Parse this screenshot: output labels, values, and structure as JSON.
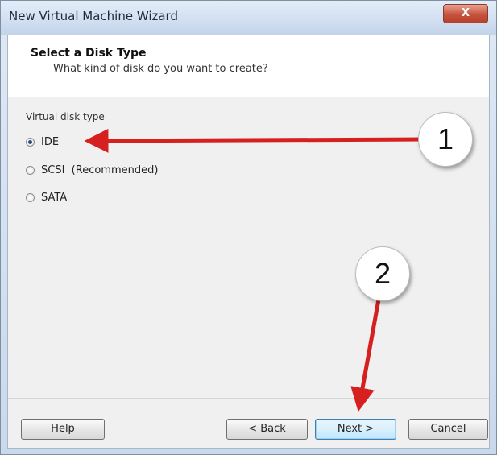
{
  "window": {
    "title": "New Virtual Machine Wizard",
    "close_label": "X"
  },
  "header": {
    "title": "Select a Disk Type",
    "subtitle": "What kind of disk do you want to create?"
  },
  "disk_type": {
    "group_label": "Virtual disk type",
    "options": [
      {
        "label": "IDE",
        "checked": true
      },
      {
        "label": "SCSI  (Recommended)",
        "checked": false
      },
      {
        "label": "SATA",
        "checked": false
      }
    ]
  },
  "buttons": {
    "help": "Help",
    "back": "< Back",
    "next": "Next >",
    "cancel": "Cancel"
  },
  "annotations": {
    "marker_1": "1",
    "marker_2": "2",
    "arrow_color": "#d62020"
  }
}
